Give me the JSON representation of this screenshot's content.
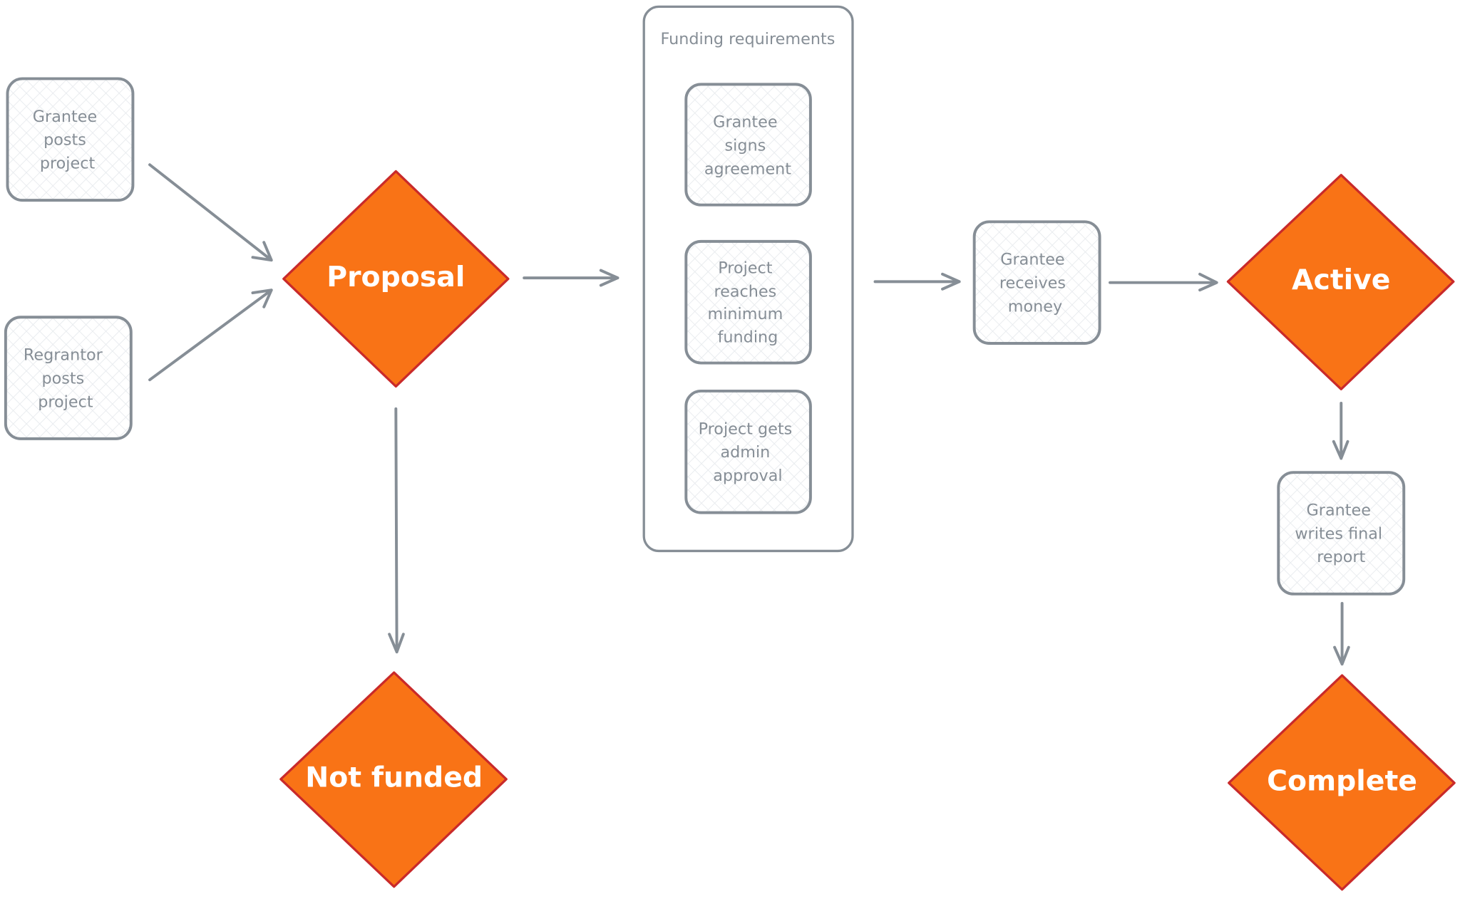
{
  "colors": {
    "state_fill": "#f97316",
    "state_stroke": "#c92a2a",
    "step_stroke": "#868e96",
    "hatch": "#dee2e6"
  },
  "steps": {
    "grantee_posts": [
      "Grantee",
      "posts",
      "project"
    ],
    "regrantor_posts": [
      "Regrantor",
      "posts",
      "project"
    ],
    "receives_money": [
      "Grantee",
      "receives",
      "money"
    ],
    "final_report": [
      "Grantee",
      "writes final",
      "report"
    ]
  },
  "states": {
    "proposal": "Proposal",
    "not_funded": "Not funded",
    "active": "Active",
    "complete": "Complete"
  },
  "funding_requirements": {
    "title": "Funding requirements",
    "items": [
      [
        "Grantee",
        "signs",
        "agreement"
      ],
      [
        "Project",
        "reaches",
        "minimum",
        "funding"
      ],
      [
        "Project gets",
        "admin",
        "approval"
      ]
    ]
  }
}
